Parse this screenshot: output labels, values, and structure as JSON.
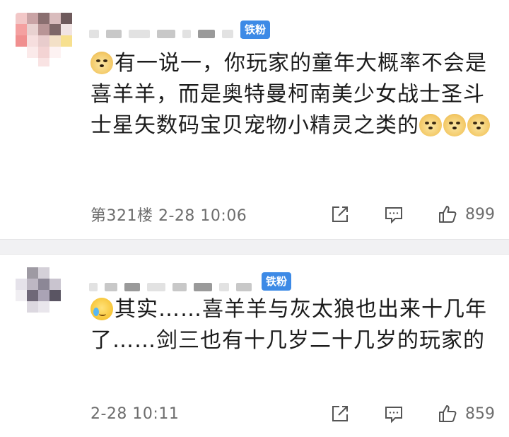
{
  "colors": {
    "badge": "#3d8ae6",
    "separator": "#f1f1f3",
    "meta_text": "#6d6d6d",
    "body_text": "#1c1c1c"
  },
  "comments": [
    {
      "badge": "铁粉",
      "text_parts": [
        {
          "type": "emoji",
          "icon": "doge-emoji-icon"
        },
        {
          "type": "text",
          "value": "有一说一，你玩家的童年大概率不会是喜羊羊，而是奥特曼柯南美少女战士圣斗士星矢数码宝贝宠物小精灵之类的"
        },
        {
          "type": "emoji",
          "icon": "doge-emoji-icon"
        },
        {
          "type": "emoji",
          "icon": "doge-emoji-icon"
        },
        {
          "type": "emoji",
          "icon": "doge-emoji-icon"
        }
      ],
      "text": "有一说一，你玩家的童年大概率不会是喜羊羊，而是奥特曼柯南美少女战士圣斗士星矢数码宝贝宠物小精灵之类的",
      "floor_label": "第321楼",
      "time": "2-28 10:06",
      "meta": "第321楼 2-28 10:06",
      "likes": "899",
      "icons": [
        "share-icon",
        "comment-icon",
        "like-icon"
      ]
    },
    {
      "badge": "铁粉",
      "text": "其实……喜羊羊与灰太狼也出来十几年了……剑三也有十几岁二十几岁的玩家的",
      "leading_emoji": "crying-emoji-icon",
      "time": "2-28 10:11",
      "meta": "2-28 10:11",
      "likes": "859",
      "icons": [
        "share-icon",
        "comment-icon",
        "like-icon"
      ]
    }
  ]
}
